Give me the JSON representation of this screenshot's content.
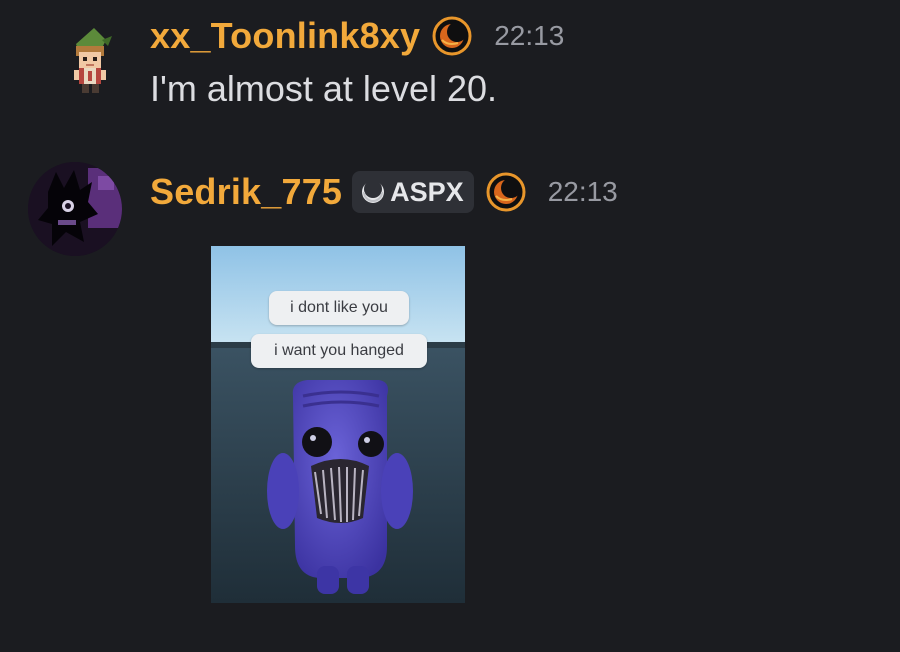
{
  "messages": [
    {
      "author": "xx_Toonlink8xy",
      "avatar_icon": "pixel-character-avatar",
      "role_icon": "orange-moon-badge-icon",
      "timestamp": "22:13",
      "text": "I'm almost at level 20."
    },
    {
      "author": "Sedrik_775",
      "avatar_icon": "dark-creature-avatar",
      "tag_icon": "clan-tag-icon",
      "tag": "ASPX",
      "role_icon": "orange-moon-badge-icon",
      "timestamp": "22:13",
      "attachment": {
        "bubble_1": "i dont like you",
        "bubble_2": "i want you hanged"
      }
    }
  ],
  "colors": {
    "background": "#1b1c20",
    "username": "#f2a93b",
    "timestamp": "#989aa2",
    "message_text": "#dcdde1"
  }
}
